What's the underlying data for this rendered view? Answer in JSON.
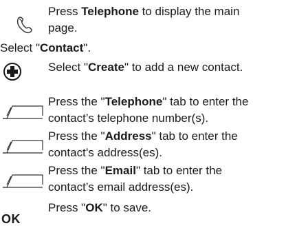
{
  "steps": [
    {
      "icon": "handset-icon",
      "lines": [
        {
          "pre": "Press ",
          "bold": "Telephone",
          "post": " to display the main"
        },
        {
          "pre": "page.",
          "bold": "",
          "post": ""
        }
      ]
    },
    {
      "icon": "",
      "lines": [
        {
          "pre": "Select \"",
          "bold": "Contact",
          "post": "\"."
        }
      ]
    },
    {
      "icon": "plus-circle-icon",
      "lines": [
        {
          "pre": "Select \"",
          "bold": "Create",
          "post": "\" to add a new contact."
        }
      ]
    },
    {
      "icon": "tab-icon",
      "lines": [
        {
          "pre": "Press the \"",
          "bold": "Telephone",
          "post": "\" tab to enter the"
        },
        {
          "pre": "contact’s telephone number(s).",
          "bold": "",
          "post": ""
        }
      ]
    },
    {
      "icon": "tab-icon",
      "lines": [
        {
          "pre": "Press the \"",
          "bold": "Address",
          "post": "\" tab to enter the"
        },
        {
          "pre": "contact’s address(es).",
          "bold": "",
          "post": ""
        }
      ]
    },
    {
      "icon": "tab-icon",
      "lines": [
        {
          "pre": "Press the \"",
          "bold": "Email",
          "post": "\" tab to enter the"
        },
        {
          "pre": "contact’s email address(es).",
          "bold": "",
          "post": ""
        }
      ]
    },
    {
      "icon": "ok-label",
      "ok_label": "OK",
      "lines": [
        {
          "pre": "Press \"",
          "bold": "OK",
          "post": "\" to save."
        }
      ]
    }
  ]
}
